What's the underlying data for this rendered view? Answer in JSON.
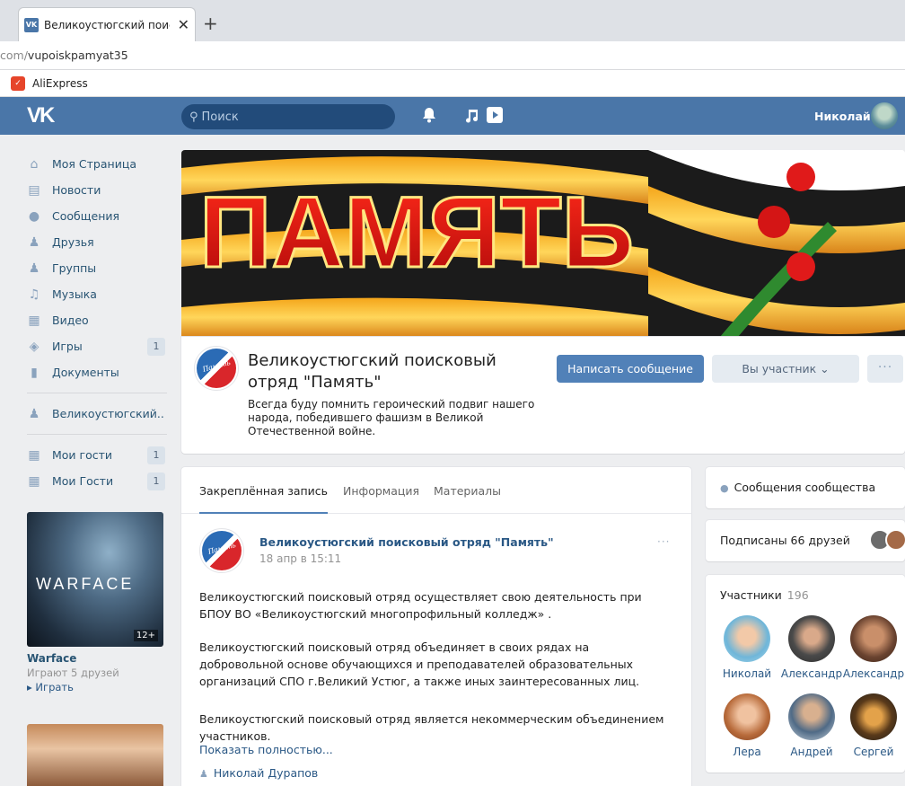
{
  "browser": {
    "tab_title": "Великоустюгский поиско",
    "tab_favicon": "vk",
    "new_tab": "+",
    "close": "✕",
    "address_prefix": "com/",
    "address_path": "vupoiskpamyat35",
    "bookmark_label": "AliExpress"
  },
  "vk_header": {
    "search_placeholder": "Поиск",
    "user_name": "Николай"
  },
  "left_menu": {
    "items": [
      {
        "label": "Моя Страница",
        "icon": "home-icon"
      },
      {
        "label": "Новости",
        "icon": "news-icon"
      },
      {
        "label": "Сообщения",
        "icon": "messages-icon"
      },
      {
        "label": "Друзья",
        "icon": "friends-icon"
      },
      {
        "label": "Группы",
        "icon": "groups-icon"
      },
      {
        "label": "Музыка",
        "icon": "music-icon"
      },
      {
        "label": "Видео",
        "icon": "video-icon"
      },
      {
        "label": "Игры",
        "icon": "games-icon",
        "badge": "1"
      },
      {
        "label": "Документы",
        "icon": "documents-icon"
      }
    ],
    "group_item": "Великоустюгский..",
    "guests": [
      {
        "label": "Мои гости",
        "badge": "1"
      },
      {
        "label": "Мои Гости",
        "badge": "1"
      }
    ]
  },
  "game_ad": {
    "logo": "WARFACE",
    "age": "12+",
    "title": "Warface",
    "subtitle": "Играют 5 друзей",
    "play": "▸ Играть"
  },
  "cover": {
    "text": "ПАМЯТЬ"
  },
  "group": {
    "name": "Великоустюгский поисковый отряд \"Память\"",
    "status": "Всегда буду помнить героический подвиг нашего народа, победившего фашизм в Великой Отечественной войне.",
    "avatar_text": "Память",
    "write_button": "Написать сообщение",
    "member_button": "Вы участник ⌄",
    "more_button": "···"
  },
  "wall": {
    "tabs": [
      "Закреплённая запись",
      "Информация",
      "Материалы"
    ],
    "post": {
      "author": "Великоустюгский поисковый отряд \"Память\"",
      "date": "18 апр в 15:11",
      "more": "···",
      "paragraphs": [
        "Великоустюгский поисковый отряд осуществляет свою деятельность при БПОУ ВО «Великоустюгский многопрофильный колледж» .",
        "Великоустюгский поисковый отряд объединяет в своих рядах на добровольной основе обучающихся и преподавателей образовательных организаций СПО г.Великий Устюг, а также иных заинтересованных лиц.",
        "Великоустюгский поисковый отряд является некоммерческим объединением участников."
      ],
      "show_more": "Показать полностью...",
      "signer": "Николай Дурапов"
    }
  },
  "right_column": {
    "community_messages": "Сообщения сообщества",
    "friends_subscribed": "Подписаны 66 друзей",
    "members_title": "Участники",
    "members_count": "196",
    "members": [
      "Николай",
      "Александр",
      "Александр",
      "Лера",
      "Андрей",
      "Сергей"
    ]
  },
  "colors": {
    "vk_blue": "#4a76a8",
    "button_blue": "#5181b8",
    "link": "#2a5885",
    "page_bg": "#edeef0"
  }
}
